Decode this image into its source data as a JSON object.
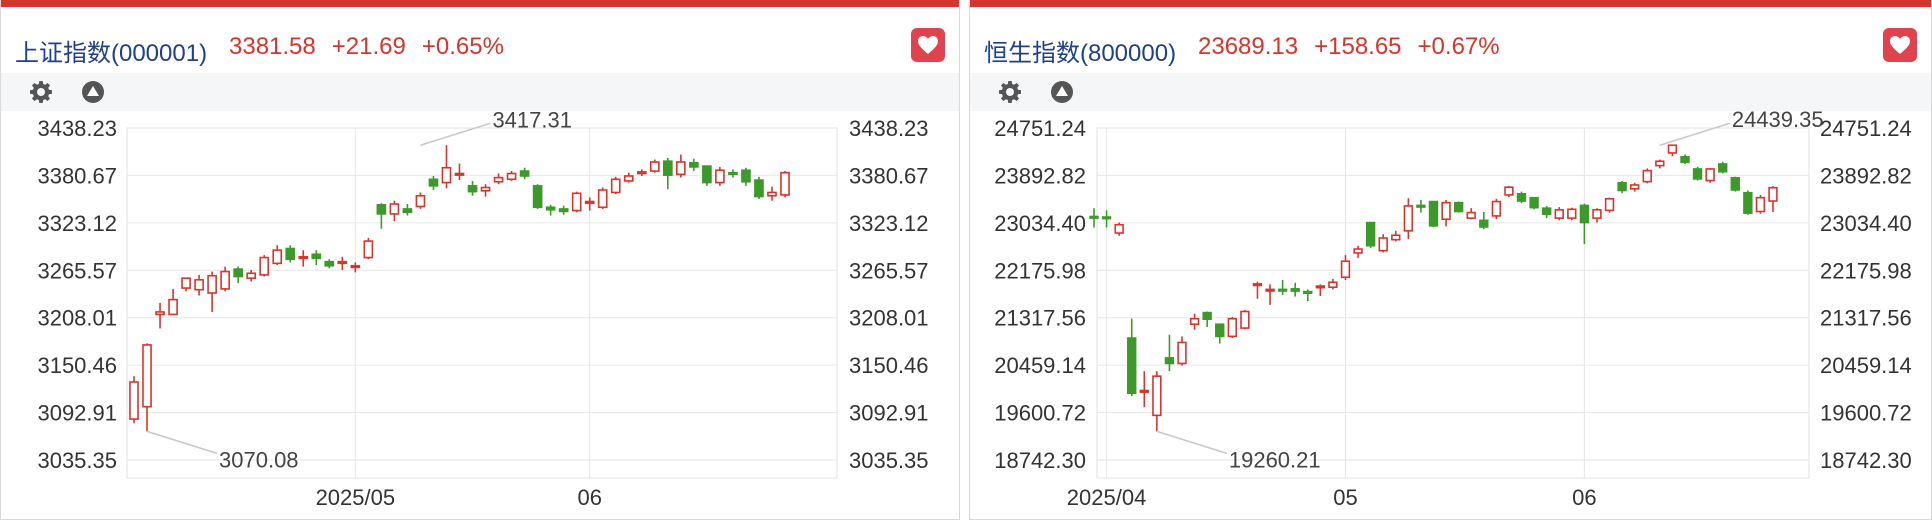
{
  "panels": [
    {
      "name": "上证指数(000001)",
      "price": "3381.58",
      "change": "+21.69",
      "pct": "+0.65%",
      "icons": {
        "favorite": "heart-icon",
        "settings": "gear-icon",
        "collapse": "triangle-up-icon"
      }
    },
    {
      "name": "恒生指数(800000)",
      "price": "23689.13",
      "change": "+158.65",
      "pct": "+0.67%",
      "icons": {
        "favorite": "heart-icon",
        "settings": "gear-icon",
        "collapse": "triangle-up-icon"
      }
    }
  ],
  "colors": {
    "up": "#d9342b",
    "down": "#3c9a2b",
    "title": "#1f3f8f",
    "accent": "#d9342b"
  },
  "chart_data": [
    {
      "type": "candlestick",
      "title": "上证指数(000001)",
      "y_ticks": [
        "3438.23",
        "3380.67",
        "3323.12",
        "3265.57",
        "3208.01",
        "3150.46",
        "3092.91",
        "3035.35"
      ],
      "ylim": [
        3035.35,
        3438.23
      ],
      "x_ticks": [
        "2025/05",
        "06"
      ],
      "x_tick_index": [
        17,
        35
      ],
      "annotations": [
        {
          "text": "3417.31",
          "index": 22,
          "value": 3417.31
        },
        {
          "text": "3070.08",
          "index": 1,
          "value": 3070.08
        }
      ],
      "ohlc": [
        [
          3085,
          3130,
          3080,
          3137
        ],
        [
          3100,
          3175,
          3070.08,
          3177
        ],
        [
          3212,
          3215,
          3195,
          3226
        ],
        [
          3212,
          3230,
          3212,
          3243
        ],
        [
          3244,
          3256,
          3240,
          3256
        ],
        [
          3242,
          3254,
          3235,
          3260
        ],
        [
          3238,
          3259,
          3215,
          3264
        ],
        [
          3243,
          3264,
          3240,
          3270
        ],
        [
          3267,
          3258,
          3250,
          3270
        ],
        [
          3256,
          3262,
          3252,
          3266
        ],
        [
          3260,
          3281,
          3258,
          3284
        ],
        [
          3274,
          3290,
          3272,
          3296
        ],
        [
          3292,
          3279,
          3275,
          3296
        ],
        [
          3282,
          3282,
          3270,
          3290
        ],
        [
          3285,
          3280,
          3272,
          3290
        ],
        [
          3276,
          3271,
          3268,
          3279
        ],
        [
          3274,
          3276,
          3266,
          3282
        ],
        [
          3270,
          3271,
          3263,
          3275
        ],
        [
          3281,
          3301,
          3279,
          3305
        ],
        [
          3345,
          3334,
          3316,
          3347
        ],
        [
          3334,
          3346,
          3325,
          3350
        ],
        [
          3340,
          3336,
          3332,
          3346
        ],
        [
          3343,
          3356,
          3340,
          3360
        ],
        [
          3376,
          3368,
          3363,
          3380
        ],
        [
          3372,
          3390,
          3365,
          3417.31
        ],
        [
          3382,
          3383,
          3375,
          3395
        ],
        [
          3368,
          3361,
          3356,
          3374
        ],
        [
          3362,
          3366,
          3355,
          3370
        ],
        [
          3373,
          3378,
          3370,
          3383
        ],
        [
          3376,
          3383,
          3374,
          3386
        ],
        [
          3386,
          3380,
          3376,
          3390
        ],
        [
          3368,
          3342,
          3340,
          3370
        ],
        [
          3342,
          3339,
          3332,
          3345
        ],
        [
          3340,
          3337,
          3333,
          3344
        ],
        [
          3338,
          3359,
          3336,
          3361
        ],
        [
          3347,
          3349,
          3338,
          3354
        ],
        [
          3342,
          3363,
          3340,
          3366
        ],
        [
          3360,
          3376,
          3358,
          3379
        ],
        [
          3374,
          3380,
          3372,
          3384
        ],
        [
          3383,
          3385,
          3380,
          3388
        ],
        [
          3386,
          3397,
          3384,
          3400
        ],
        [
          3398,
          3381,
          3364,
          3402
        ],
        [
          3382,
          3397,
          3378,
          3406
        ],
        [
          3396,
          3391,
          3386,
          3401
        ],
        [
          3392,
          3372,
          3368,
          3393
        ],
        [
          3372,
          3387,
          3368,
          3391
        ],
        [
          3384,
          3383,
          3378,
          3388
        ],
        [
          3387,
          3373,
          3368,
          3390
        ],
        [
          3375,
          3355,
          3352,
          3379
        ],
        [
          3356,
          3360,
          3350,
          3367
        ],
        [
          3357,
          3384,
          3354,
          3386
        ]
      ]
    },
    {
      "type": "candlestick",
      "title": "恒生指数(800000)",
      "y_ticks": [
        "24751.24",
        "23892.82",
        "23034.40",
        "22175.98",
        "21317.56",
        "20459.14",
        "19600.72",
        "18742.30"
      ],
      "ylim": [
        18742.3,
        24751.24
      ],
      "x_ticks": [
        "2025/04",
        "05",
        "06"
      ],
      "x_tick_index": [
        1,
        20,
        39
      ],
      "annotations": [
        {
          "text": "24439.35",
          "index": 45,
          "value": 24439.35
        },
        {
          "text": "19260.21",
          "index": 5,
          "value": 19260.21
        }
      ],
      "ohlc": [
        [
          23150,
          23130,
          22950,
          23300
        ],
        [
          23140,
          23120,
          22950,
          23260
        ],
        [
          22850,
          23000,
          22800,
          23040
        ],
        [
          20950,
          19950,
          19900,
          21300
        ],
        [
          20000,
          20000,
          19700,
          20350
        ],
        [
          19550,
          20260,
          19260.21,
          20350
        ],
        [
          20590,
          20490,
          20350,
          21010
        ],
        [
          20490,
          20870,
          20450,
          20980
        ],
        [
          21200,
          21300,
          21100,
          21390
        ],
        [
          21410,
          21290,
          21150,
          21430
        ],
        [
          21200,
          20980,
          20850,
          21200
        ],
        [
          20980,
          21300,
          20950,
          21330
        ],
        [
          21130,
          21430,
          21110,
          21460
        ],
        [
          21910,
          21930,
          21660,
          21970
        ],
        [
          21810,
          21830,
          21550,
          21920
        ],
        [
          21830,
          21810,
          21730,
          22000
        ],
        [
          21840,
          21800,
          21700,
          21950
        ],
        [
          21790,
          21760,
          21620,
          21830
        ],
        [
          21870,
          21890,
          21710,
          21920
        ],
        [
          21870,
          21960,
          21830,
          22020
        ],
        [
          22050,
          22340,
          22000,
          22450
        ],
        [
          22490,
          22560,
          22400,
          22620
        ],
        [
          23040,
          22620,
          22580,
          23040
        ],
        [
          22530,
          22760,
          22500,
          22830
        ],
        [
          22730,
          22810,
          22700,
          22890
        ],
        [
          22890,
          23340,
          22740,
          23480
        ],
        [
          23350,
          23330,
          23220,
          23450
        ],
        [
          23420,
          22980,
          22960,
          23420
        ],
        [
          23100,
          23400,
          22970,
          23450
        ],
        [
          23400,
          23240,
          23220,
          23420
        ],
        [
          23120,
          23220,
          23100,
          23300
        ],
        [
          23080,
          22960,
          22920,
          23230
        ],
        [
          23160,
          23420,
          23100,
          23470
        ],
        [
          23540,
          23680,
          23500,
          23700
        ],
        [
          23560,
          23430,
          23390,
          23600
        ],
        [
          23490,
          23310,
          23280,
          23500
        ],
        [
          23300,
          23190,
          23120,
          23340
        ],
        [
          23120,
          23270,
          23080,
          23320
        ],
        [
          23120,
          23280,
          23080,
          23310
        ],
        [
          23350,
          23040,
          22650,
          23380
        ],
        [
          23120,
          23270,
          23040,
          23300
        ],
        [
          23260,
          23470,
          23220,
          23490
        ],
        [
          23760,
          23620,
          23570,
          23790
        ],
        [
          23650,
          23720,
          23600,
          23760
        ],
        [
          23780,
          23980,
          23750,
          24020
        ],
        [
          24070,
          24150,
          24020,
          24180
        ],
        [
          24300,
          24439.35,
          24240,
          24439.35
        ],
        [
          24230,
          24130,
          24100,
          24270
        ],
        [
          24010,
          23830,
          23800,
          24050
        ],
        [
          23800,
          24010,
          23760,
          24030
        ],
        [
          24100,
          23960,
          23930,
          24140
        ],
        [
          23850,
          23630,
          23600,
          23870
        ],
        [
          23580,
          23210,
          23180,
          23620
        ],
        [
          23240,
          23490,
          23200,
          23540
        ],
        [
          23430,
          23670,
          23230,
          23700
        ]
      ]
    }
  ]
}
